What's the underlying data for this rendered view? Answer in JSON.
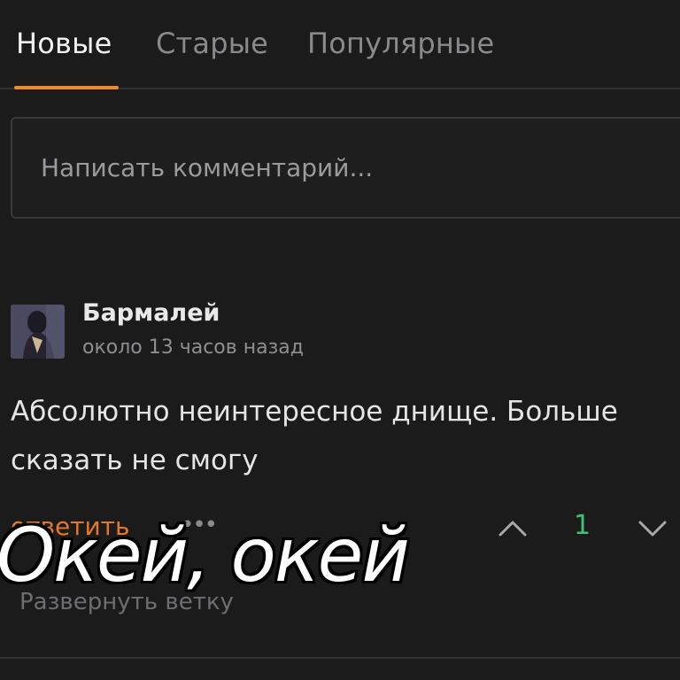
{
  "tabs": [
    {
      "label": "Новые",
      "active": true
    },
    {
      "label": "Старые",
      "active": false
    },
    {
      "label": "Популярные",
      "active": false
    }
  ],
  "comment_box": {
    "placeholder": "Написать комментарий..."
  },
  "comment": {
    "author": "Бармалей",
    "time": "около 13 часов назад",
    "text": "Абсолютно неинтересное днище. Больше сказать не смогу",
    "reply_label": "ответить",
    "more_icon": "more-dots-icon",
    "vote_count": "1",
    "expand_label": "Развернуть ветку"
  },
  "overlay_caption": "Окей, окей",
  "colors": {
    "accent": "#f08a24",
    "reply": "#e5762a",
    "vote_positive": "#3fbf77",
    "background": "#1b1b1c"
  }
}
